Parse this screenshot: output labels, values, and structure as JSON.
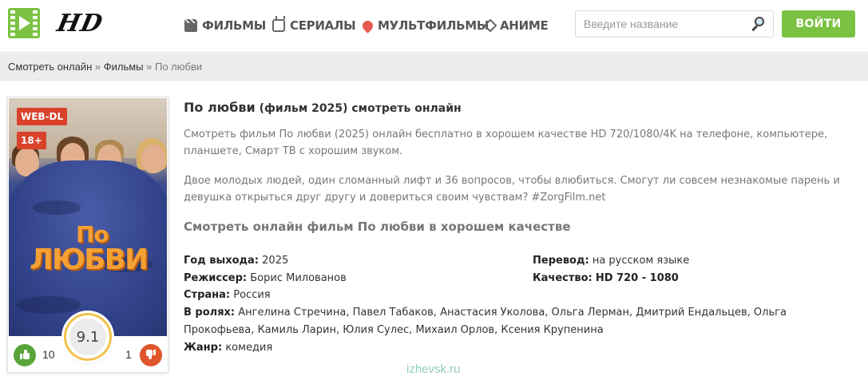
{
  "header": {
    "logo_text": "HD",
    "nav": [
      {
        "label": "ФИЛЬМЫ",
        "icon": "clapperboard-icon"
      },
      {
        "label": "СЕРИАЛЫ",
        "icon": "tv-icon"
      },
      {
        "label": "МУЛЬТФИЛЬМЫ",
        "icon": "balloon-icon"
      },
      {
        "label": "АНИМЕ",
        "icon": "anime-icon"
      }
    ],
    "search_placeholder": "Введите название",
    "login_label": "ВОЙТИ"
  },
  "breadcrumb": {
    "home": "Смотреть онлайн",
    "sep1": " » ",
    "section": "Фильмы",
    "sep2": " » ",
    "current": "По любви"
  },
  "poster": {
    "badge_quality": "WEB-DL",
    "badge_age": "18+",
    "title_line1": "По",
    "title_line2": "ЛЮБВИ",
    "rating": "9.1",
    "likes": "10",
    "dislikes": "1"
  },
  "movie": {
    "title_main": "По любви",
    "title_sub": " (фильм 2025) смотреть онлайн",
    "description_1": "Смотреть фильм По любви (2025) онлайн бесплатно в хорошем качестве HD 720/1080/4K на телефоне, компьютере, планшете, Смарт ТВ с хорошим звуком.",
    "description_2": "Двое молодых людей, один сломанный лифт и 36 вопросов, чтобы влюбиться. Смогут ли совсем незнакомые парень и девушка открыться друг другу и довериться своим чувствам? #ZorgFilm.net",
    "watch_heading": "Смотреть онлайн фильм По любви в хорошем качестве",
    "info": {
      "year_label": "Год выхода:",
      "year": "2025",
      "director_label": "Режиссер:",
      "director": "Борис Милованов",
      "country_label": "Страна:",
      "country": "Россия",
      "cast_label": "В ролях:",
      "cast": "Ангелина Стречина, Павел Табаков, Анастасия Уколова, Ольга Лерман, Дмитрий Ендальцев, Ольга Прокофьева, Камиль Ларин, Юлия Сулес, Михаил Орлов, Ксения Крупенина",
      "genre_label": "Жанр:",
      "genre": "комедия",
      "translation_label": "Перевод:",
      "translation": "на русском языке",
      "quality_label": "Качество:",
      "quality": "HD 720 - 1080"
    }
  },
  "watermark": "izhevsk.ru",
  "colors": {
    "accent_green": "#7cc242",
    "badge_red": "#d9422b",
    "like_green": "#5aa53a",
    "dislike_orange": "#e0562b",
    "rating_ring": "#f0c24c"
  }
}
